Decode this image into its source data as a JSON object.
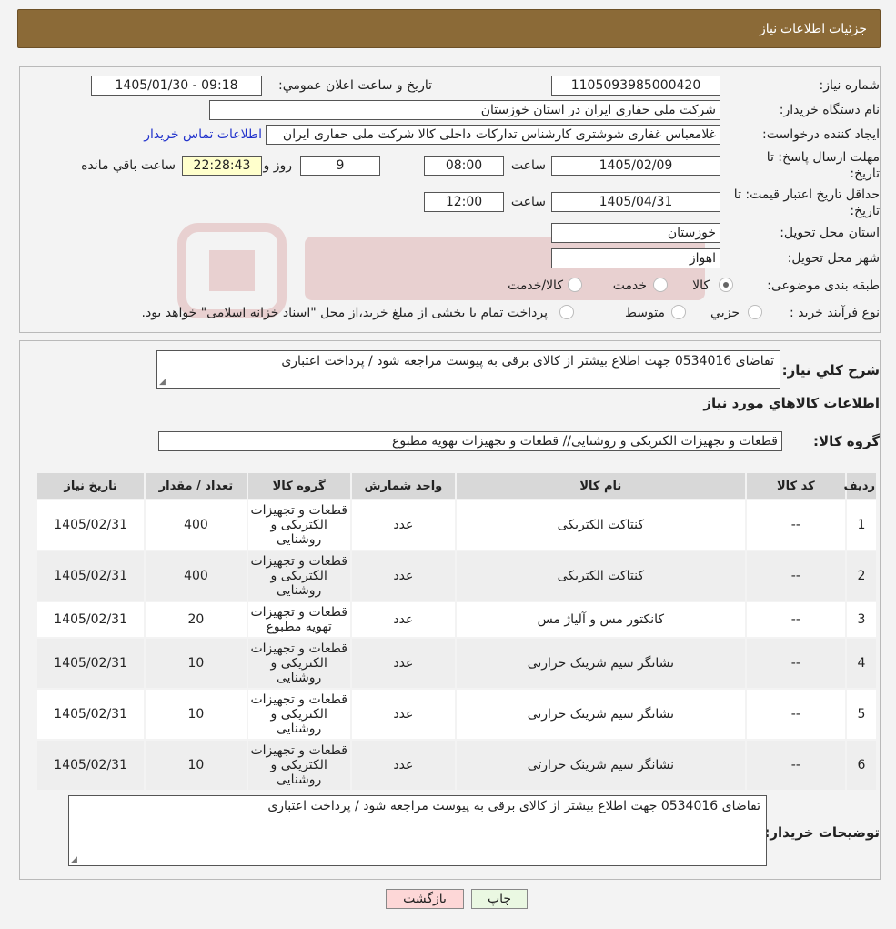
{
  "header": {
    "title": "جزئیات اطلاعات نیاز"
  },
  "general": {
    "need_number_label": "شماره نیاز:",
    "need_number": "1105093985000420",
    "announce_label": "تاریخ و ساعت اعلان عمومي:",
    "announce_value": "1405/01/30 - 09:18",
    "buyer_label": "نام دستگاه خریدار:",
    "buyer_value": "شرکت ملی حفاری ایران در استان خوزستان",
    "creator_label": "ایجاد کننده درخواست:",
    "creator_value": "غلامعباس غفاری شوشتری کارشناس تدارکات داخلی کالا شرکت ملی حفاری ایران",
    "contact_link": "اطلاعات تماس خریدار",
    "deadline_label_1": "مهلت ارسال پاسخ: تا",
    "deadline_label_2": "تاریخ:",
    "deadline_date": "1405/02/09",
    "time_label": "ساعت",
    "deadline_time": "08:00",
    "days_value": "9",
    "days_label": "روز و",
    "remaining_value": "22:28:43",
    "remaining_label": "ساعت باقي مانده",
    "validity_label_1": "حداقل تاریخ اعتبار قیمت: تا",
    "validity_label_2": "تاریخ:",
    "validity_date": "1405/04/31",
    "validity_time": "12:00",
    "province_label": "استان محل تحویل:",
    "province_value": "خوزستان",
    "city_label": "شهر محل تحویل:",
    "city_value": "اهواز",
    "category_label": "طبقه بندی موضوعی:",
    "category_options": [
      "کالا",
      "خدمت",
      "کالا/خدمت"
    ],
    "category_selected": "کالا",
    "process_label": "نوع فرآیند خرید :",
    "process_options": [
      "جزيي",
      "متوسط"
    ],
    "payment_note": "پرداخت تمام یا بخشی از مبلغ خرید،از محل \"اسناد خزانه اسلامی\" خواهد بود."
  },
  "summary": {
    "description_label": "شرح کلي نياز:",
    "description_value": "تقاضای  0534016 جهت اطلاع بیشتر از کالای برقی به پیوست مراجعه شود / پرداخت اعتباری",
    "items_heading": "اطلاعات کالاهاي مورد نياز",
    "group_label": "گروه کالا:",
    "group_value": "قطعات و تجهیزات الکتریکی و روشنایی//  قطعات و تجهیزات تهویه مطبوع"
  },
  "table": {
    "headers": [
      "رديف",
      "کد کالا",
      "نام کالا",
      "واحد شمارش",
      "گروه کالا",
      "تعداد / مقدار",
      "تاریخ نیاز"
    ],
    "rows": [
      [
        "1",
        "--",
        "کنتاکت الکتریکی",
        "عدد",
        "قطعات و تجهیزات الکتریکی و روشنایی",
        "400",
        "1405/02/31"
      ],
      [
        "2",
        "--",
        "کنتاکت الکتریکی",
        "عدد",
        "قطعات و تجهیزات الکتریکی و روشنایی",
        "400",
        "1405/02/31"
      ],
      [
        "3",
        "--",
        "کانکتور مس و آلیاژ مس",
        "عدد",
        "قطعات و تجهیزات تهویه مطبوع",
        "20",
        "1405/02/31"
      ],
      [
        "4",
        "--",
        "نشانگر سیم شرینک حرارتی",
        "عدد",
        "قطعات و تجهیزات الکتریکی و روشنایی",
        "10",
        "1405/02/31"
      ],
      [
        "5",
        "--",
        "نشانگر سیم شرینک حرارتی",
        "عدد",
        "قطعات و تجهیزات الکتریکی و روشنایی",
        "10",
        "1405/02/31"
      ],
      [
        "6",
        "--",
        "نشانگر سیم شرینک حرارتی",
        "عدد",
        "قطعات و تجهیزات الکتریکی و روشنایی",
        "10",
        "1405/02/31"
      ]
    ]
  },
  "buyer_notes": {
    "label": "توضیحات خریدار:",
    "value": "تقاضای  0534016 جهت اطلاع بیشتر از کالای برقی به پیوست مراجعه شود / پرداخت اعتباری"
  },
  "buttons": {
    "print": "چاپ",
    "back": "بازگشت"
  },
  "colors": {
    "header_bg": "#8b6a37",
    "back_button_bg": "#fdd7d7",
    "print_button_bg": "#eaf8e2",
    "link": "#2233cc"
  }
}
